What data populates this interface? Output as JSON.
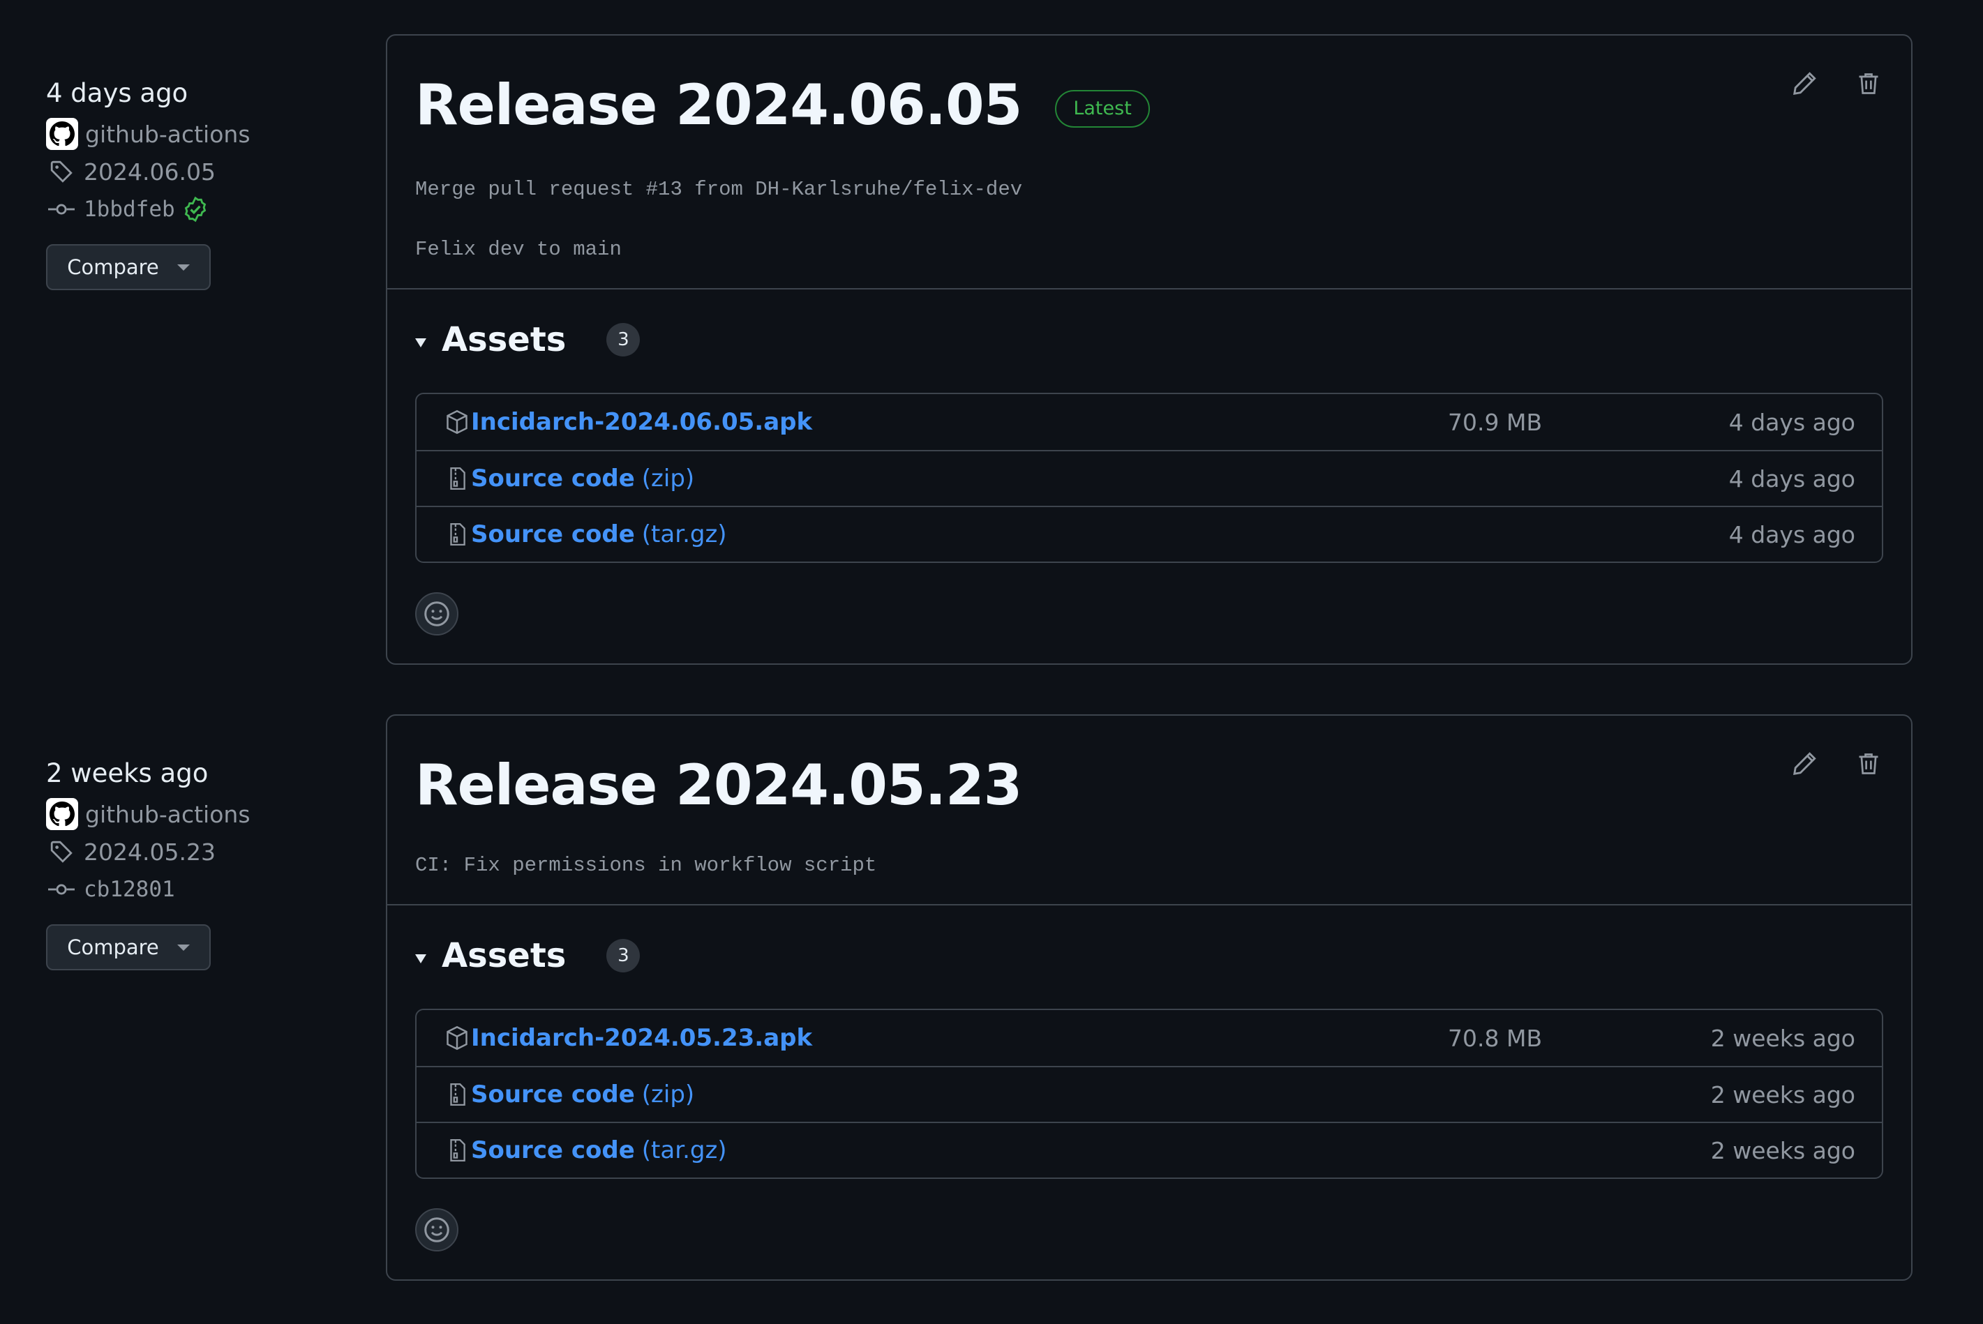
{
  "releases": [
    {
      "date": "4 days ago",
      "author": "github-actions",
      "tag": "2024.06.05",
      "commit": "1bbdfeb",
      "verified": true,
      "compare_label": "Compare",
      "title": "Release 2024.06.05",
      "badge": "Latest",
      "description": [
        "Merge pull request #13 from DH-Karlsruhe/felix-dev",
        "Felix dev to main"
      ],
      "assets_label": "Assets",
      "assets_count": "3",
      "assets": [
        {
          "name": "Incidarch-2024.06.05.apk",
          "ext": "",
          "size": "70.9 MB",
          "when": "4 days ago",
          "icon": "package-icon"
        },
        {
          "name": "Source code",
          "ext": "(zip)",
          "size": "",
          "when": "4 days ago",
          "icon": "file-zip-icon"
        },
        {
          "name": "Source code",
          "ext": "(tar.gz)",
          "size": "",
          "when": "4 days ago",
          "icon": "file-zip-icon"
        }
      ]
    },
    {
      "date": "2 weeks ago",
      "author": "github-actions",
      "tag": "2024.05.23",
      "commit": "cb12801",
      "verified": false,
      "compare_label": "Compare",
      "title": "Release 2024.05.23",
      "badge": "",
      "description": [
        "CI: Fix permissions in workflow script"
      ],
      "assets_label": "Assets",
      "assets_count": "3",
      "assets": [
        {
          "name": "Incidarch-2024.05.23.apk",
          "ext": "",
          "size": "70.8 MB",
          "when": "2 weeks ago",
          "icon": "package-icon"
        },
        {
          "name": "Source code",
          "ext": "(zip)",
          "size": "",
          "when": "2 weeks ago",
          "icon": "file-zip-icon"
        },
        {
          "name": "Source code",
          "ext": "(tar.gz)",
          "size": "",
          "when": "2 weeks ago",
          "icon": "file-zip-icon"
        }
      ]
    }
  ],
  "colors": {
    "background": "#0d1117",
    "link": "#4493f8",
    "latest_green": "#3fb950",
    "border": "#3d444d"
  }
}
